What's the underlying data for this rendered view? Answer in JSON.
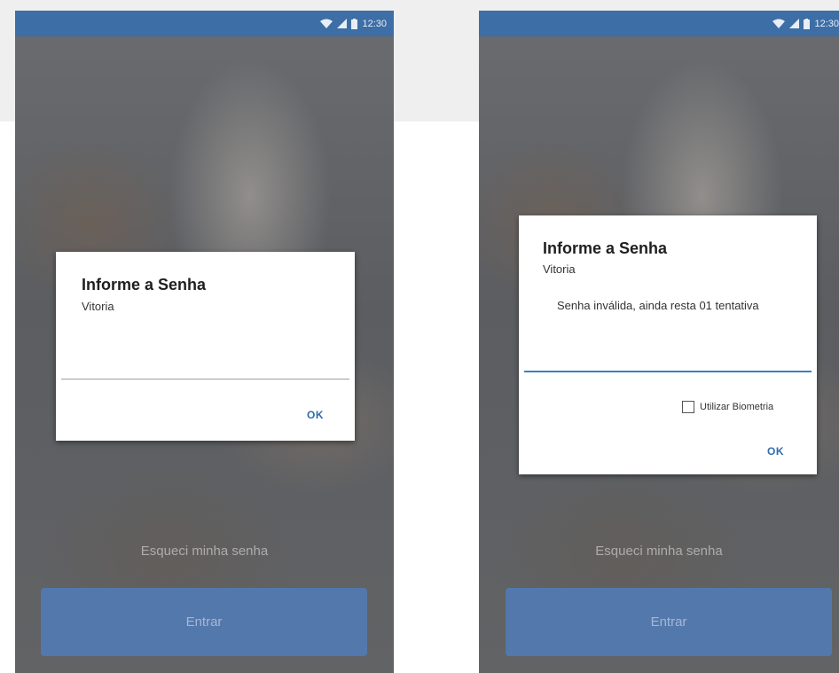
{
  "status_bar": {
    "time": "12:30"
  },
  "screens": [
    {
      "dialog": {
        "title": "Informe a Senha",
        "subtitle": "Vitoria",
        "ok_label": "OK"
      },
      "forgot_link": "Esqueci minha senha",
      "enter_button": "Entrar"
    },
    {
      "dialog": {
        "title": "Informe a Senha",
        "subtitle": "Vitoria",
        "error_message": "Senha inválida, ainda resta 01 tentativa",
        "checkbox_label": "Utilizar Biometria",
        "checkbox_checked": false,
        "ok_label": "OK"
      },
      "forgot_link": "Esqueci minha senha",
      "enter_button": "Entrar"
    }
  ],
  "colors": {
    "status_bar": "#3d6ea6",
    "accent": "#2f6bb0",
    "enter_button": "#5378ac"
  }
}
